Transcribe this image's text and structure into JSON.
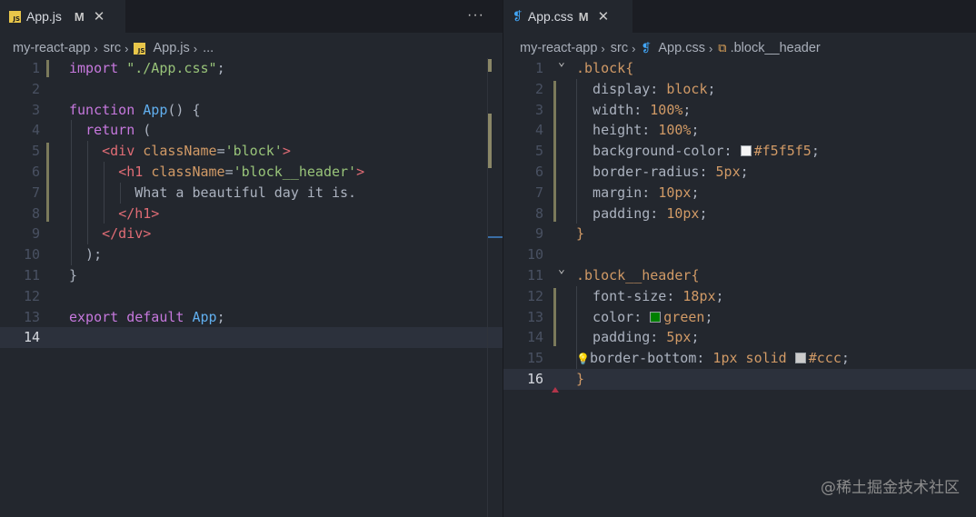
{
  "left": {
    "tab": {
      "icon": "js-file-icon",
      "icon_text": "JS",
      "name": "App.js",
      "modified": "M",
      "close": "✕"
    },
    "more": "···",
    "breadcrumb": [
      "my-react-app",
      "src",
      "App.js",
      "..."
    ],
    "lines": [
      {
        "n": "1",
        "tokens": [
          [
            "k",
            "import "
          ],
          [
            "s",
            "\"./App.css\""
          ],
          [
            "p",
            ";"
          ]
        ]
      },
      {
        "n": "2",
        "tokens": []
      },
      {
        "n": "3",
        "tokens": [
          [
            "k",
            "function "
          ],
          [
            "f",
            "App"
          ],
          [
            "p",
            "() {"
          ]
        ]
      },
      {
        "n": "4",
        "tokens": [
          [
            "p",
            "  "
          ],
          [
            "k",
            "return "
          ],
          [
            "p",
            "("
          ]
        ]
      },
      {
        "n": "5",
        "tokens": [
          [
            "p",
            "    "
          ],
          [
            "t",
            "<div "
          ],
          [
            "n",
            "className"
          ],
          [
            "p",
            "="
          ],
          [
            "s",
            "'block'"
          ],
          [
            "t",
            ">"
          ]
        ]
      },
      {
        "n": "6",
        "tokens": [
          [
            "p",
            "      "
          ],
          [
            "t",
            "<h1 "
          ],
          [
            "n",
            "className"
          ],
          [
            "p",
            "="
          ],
          [
            "s",
            "'block__header'"
          ],
          [
            "t",
            ">"
          ]
        ]
      },
      {
        "n": "7",
        "tokens": [
          [
            "p",
            "        What a beautiful day it is."
          ]
        ]
      },
      {
        "n": "8",
        "tokens": [
          [
            "p",
            "      "
          ],
          [
            "t",
            "</h1>"
          ]
        ]
      },
      {
        "n": "9",
        "tokens": [
          [
            "p",
            "    "
          ],
          [
            "t",
            "</div>"
          ]
        ]
      },
      {
        "n": "10",
        "tokens": [
          [
            "p",
            "  );"
          ]
        ]
      },
      {
        "n": "11",
        "tokens": [
          [
            "p",
            "}"
          ]
        ]
      },
      {
        "n": "12",
        "tokens": []
      },
      {
        "n": "13",
        "tokens": [
          [
            "k",
            "export default "
          ],
          [
            "f",
            "App"
          ],
          [
            "p",
            ";"
          ]
        ]
      },
      {
        "n": "14",
        "tokens": []
      }
    ],
    "current_line": "14"
  },
  "right": {
    "tab": {
      "icon": "css-file-icon",
      "icon_text": "❡",
      "name": "App.css",
      "modified": "M",
      "close": "✕"
    },
    "breadcrumb": [
      "my-react-app",
      "src",
      "App.css",
      ".block__header"
    ],
    "lines": [
      {
        "n": "1",
        "tokens": [
          [
            "sel",
            ".block"
          ],
          [
            "br",
            "{"
          ]
        ]
      },
      {
        "n": "2",
        "tokens": [
          [
            "prop",
            "  display: "
          ],
          [
            "val",
            "block"
          ],
          [
            "p",
            ";"
          ]
        ]
      },
      {
        "n": "3",
        "tokens": [
          [
            "prop",
            "  width: "
          ],
          [
            "val",
            "100%"
          ],
          [
            "p",
            ";"
          ]
        ]
      },
      {
        "n": "4",
        "tokens": [
          [
            "prop",
            "  height: "
          ],
          [
            "val",
            "100%"
          ],
          [
            "p",
            ";"
          ]
        ]
      },
      {
        "n": "5",
        "tokens": [
          [
            "prop",
            "  background-color: "
          ],
          [
            "swatch",
            "#f5f5f5"
          ],
          [
            "val",
            "#f5f5f5"
          ],
          [
            "p",
            ";"
          ]
        ]
      },
      {
        "n": "6",
        "tokens": [
          [
            "prop",
            "  border-radius: "
          ],
          [
            "val",
            "5px"
          ],
          [
            "p",
            ";"
          ]
        ]
      },
      {
        "n": "7",
        "tokens": [
          [
            "prop",
            "  margin: "
          ],
          [
            "val",
            "10px"
          ],
          [
            "p",
            ";"
          ]
        ]
      },
      {
        "n": "8",
        "tokens": [
          [
            "prop",
            "  padding: "
          ],
          [
            "val",
            "10px"
          ],
          [
            "p",
            ";"
          ]
        ]
      },
      {
        "n": "9",
        "tokens": [
          [
            "br",
            "}"
          ]
        ]
      },
      {
        "n": "10",
        "tokens": []
      },
      {
        "n": "11",
        "tokens": [
          [
            "sel",
            ".block__header"
          ],
          [
            "br",
            "{"
          ]
        ]
      },
      {
        "n": "12",
        "tokens": [
          [
            "prop",
            "  font-size: "
          ],
          [
            "val",
            "18px"
          ],
          [
            "p",
            ";"
          ]
        ]
      },
      {
        "n": "13",
        "tokens": [
          [
            "prop",
            "  color: "
          ],
          [
            "swatch",
            "#008000"
          ],
          [
            "val",
            "green"
          ],
          [
            "p",
            ";"
          ]
        ]
      },
      {
        "n": "14",
        "tokens": [
          [
            "prop",
            "  padding: "
          ],
          [
            "val",
            "5px"
          ],
          [
            "p",
            ";"
          ]
        ]
      },
      {
        "n": "15",
        "tokens": [
          [
            "bulb",
            "💡"
          ],
          [
            "prop",
            "border-bottom: "
          ],
          [
            "val",
            "1px solid "
          ],
          [
            "swatch",
            "#cccccc"
          ],
          [
            "val",
            "#ccc"
          ],
          [
            "p",
            ";"
          ]
        ]
      },
      {
        "n": "16",
        "tokens": [
          [
            "br",
            "}"
          ]
        ]
      }
    ],
    "current_line": "16",
    "fold_icon": "⌄"
  },
  "watermark": "@稀土掘金技术社区",
  "colors": {
    "keyword": "#c678dd",
    "string": "#98c379",
    "function": "#61afef",
    "tag": "#e06c75",
    "attr": "#d19a66",
    "background": "#23272e"
  }
}
